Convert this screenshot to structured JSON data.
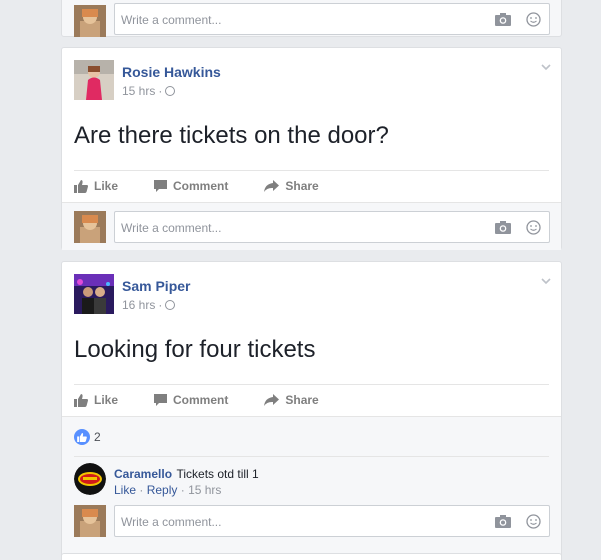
{
  "colors": {
    "link": "#365899",
    "muted": "#90949c",
    "like_blue": "#5890ff"
  },
  "comment_placeholder": "Write a comment...",
  "action_labels": {
    "like": "Like",
    "comment": "Comment",
    "share": "Share"
  },
  "posts": [
    {
      "author": "Rosie Hawkins",
      "time": "15 hrs",
      "text": "Are there tickets on the door?"
    },
    {
      "author": "Sam Piper",
      "time": "16 hrs",
      "text": "Looking for four tickets",
      "reaction_count": "2",
      "comments": [
        {
          "author": "Caramello",
          "text": "Tickets otd till 1",
          "like": "Like",
          "reply": "Reply",
          "time": "15 hrs"
        }
      ]
    }
  ],
  "icons": [
    "camera-icon",
    "smiley-icon",
    "globe-icon",
    "chevron-down-icon",
    "like-icon",
    "comment-icon",
    "share-icon"
  ]
}
